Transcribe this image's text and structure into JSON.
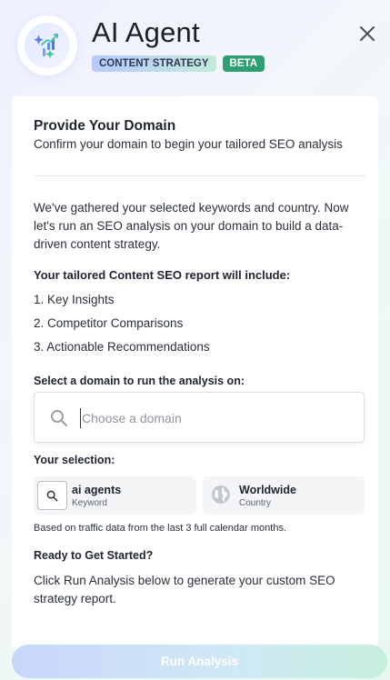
{
  "header": {
    "title": "AI Agent",
    "badge_strategy": "CONTENT STRATEGY",
    "badge_beta": "BETA"
  },
  "domain_section": {
    "title": "Provide Your Domain",
    "subtitle": "Confirm your domain to begin your tailored SEO analysis",
    "intro": "We've gathered your selected keywords and country. Now let's run an SEO analysis on your domain to build a data-driven content strategy.",
    "report_title": "Your tailored Content SEO report will include:",
    "report_items": [
      "1. Key Insights",
      "2. Competitor Comparisons",
      "3. Actionable Recommendations"
    ],
    "select_label": "Select a domain to run the analysis on:",
    "domain_placeholder": "Choose a domain",
    "domain_value": ""
  },
  "selection": {
    "label": "Your selection:",
    "keyword": {
      "value": "ai agents",
      "type": "Keyword"
    },
    "country": {
      "value": "Worldwide",
      "type": "Country"
    },
    "traffic_note": "Based on traffic data from the last 3 full calendar months."
  },
  "ready": {
    "title": "Ready to Get Started?",
    "text": "Click Run Analysis below to generate your custom SEO strategy report."
  },
  "actions": {
    "run_label": "Run Analysis"
  },
  "colors": {
    "beta_badge": "#2f9e72",
    "strategy_badge_start": "#b7c8ff",
    "strategy_badge_end": "#c2ecd8",
    "run_button_start": "#c9d6fb",
    "run_button_end": "#c6efdd"
  },
  "icons": [
    "ai-sparkle-chart-icon",
    "close-icon",
    "search-icon",
    "globe-icon"
  ]
}
